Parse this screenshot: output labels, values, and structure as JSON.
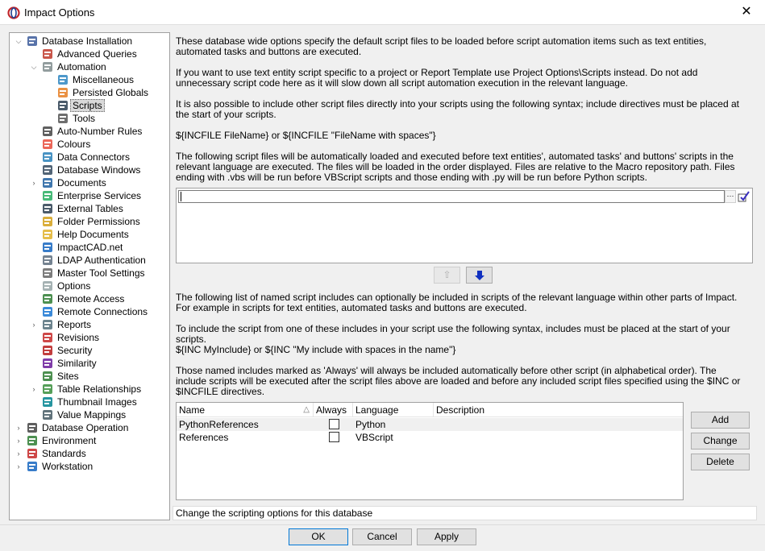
{
  "window": {
    "title": "Impact Options",
    "close_glyph": "✕"
  },
  "tree": {
    "items": [
      {
        "label": "Database Installation",
        "expander": "⌵",
        "icon": "db-install-icon"
      },
      {
        "label": "Advanced Queries",
        "expander": "",
        "icon": "sql-icon"
      },
      {
        "label": "Automation",
        "expander": "⌵",
        "icon": "gears-icon"
      },
      {
        "label": "Miscellaneous",
        "expander": "",
        "icon": "gears-icon"
      },
      {
        "label": "Persisted Globals",
        "expander": "",
        "icon": "globals-icon"
      },
      {
        "label": "Scripts",
        "expander": "",
        "icon": "script-icon"
      },
      {
        "label": "Tools",
        "expander": "",
        "icon": "tools-icon"
      },
      {
        "label": "Auto-Number Rules",
        "expander": "",
        "icon": "numbers-icon"
      },
      {
        "label": "Colours",
        "expander": "",
        "icon": "colours-icon"
      },
      {
        "label": "Data Connectors",
        "expander": "",
        "icon": "connectors-icon"
      },
      {
        "label": "Database Windows",
        "expander": "",
        "icon": "windows-icon"
      },
      {
        "label": "Documents",
        "expander": "›",
        "icon": "documents-icon"
      },
      {
        "label": "Enterprise Services",
        "expander": "",
        "icon": "enterprise-icon"
      },
      {
        "label": "External Tables",
        "expander": "",
        "icon": "tables-icon"
      },
      {
        "label": "Folder Permissions",
        "expander": "",
        "icon": "folder-icon"
      },
      {
        "label": "Help Documents",
        "expander": "",
        "icon": "help-icon"
      },
      {
        "label": "ImpactCAD.net",
        "expander": "",
        "icon": "globe-icon"
      },
      {
        "label": "LDAP Authentication",
        "expander": "",
        "icon": "ldap-icon"
      },
      {
        "label": "Master Tool Settings",
        "expander": "",
        "icon": "master-tool-icon"
      },
      {
        "label": "Options",
        "expander": "",
        "icon": "options-icon"
      },
      {
        "label": "Remote Access",
        "expander": "",
        "icon": "remote-access-icon"
      },
      {
        "label": "Remote Connections",
        "expander": "",
        "icon": "remote-connections-icon"
      },
      {
        "label": "Reports",
        "expander": "›",
        "icon": "reports-icon"
      },
      {
        "label": "Revisions",
        "expander": "",
        "icon": "revisions-icon"
      },
      {
        "label": "Security",
        "expander": "",
        "icon": "security-icon"
      },
      {
        "label": "Similarity",
        "expander": "",
        "icon": "similarity-icon"
      },
      {
        "label": "Sites",
        "expander": "",
        "icon": "sites-icon"
      },
      {
        "label": "Table Relationships",
        "expander": "›",
        "icon": "relationships-icon"
      },
      {
        "label": "Thumbnail Images",
        "expander": "",
        "icon": "thumbnail-icon"
      },
      {
        "label": "Value Mappings",
        "expander": "",
        "icon": "mappings-icon"
      },
      {
        "label": "Database Operation",
        "expander": "›",
        "icon": "db-operation-icon"
      },
      {
        "label": "Environment",
        "expander": "›",
        "icon": "environment-icon"
      },
      {
        "label": "Standards",
        "expander": "›",
        "icon": "standards-icon"
      },
      {
        "label": "Workstation",
        "expander": "›",
        "icon": "workstation-icon"
      }
    ]
  },
  "main": {
    "para1": "These database wide options specify the default script files to be loaded before script automation items such as text entities, automated tasks and buttons are executed.",
    "para2": "If you want to use text entity script specific to a project or Report Template use Project Options\\Scripts instead. Do not add unnecessary script code here as it will slow down all script automation execution in the relevant language.",
    "para3": "It is also possible to include other script files directly into your scripts using the following syntax; include directives must be placed at the start of your scripts.",
    "para4": "${INCFILE FileName} or ${INCFILE \"FileName with spaces\"}",
    "para5": "The following script files will be automatically loaded and executed before text entities', automated tasks' and buttons' scripts in the relevant language are executed. The files will be loaded in the order displayed. Files are relative to the Macro repository path. Files ending with .vbs will be run before VBScript scripts and those ending with .py will be run before Python scripts.",
    "file_input_value": "",
    "browse_label": "···",
    "para6": "The following list of named script includes can optionally be included in scripts of the relevant language within other parts of Impact. For example in scripts for text entities, automated tasks and buttons are executed.",
    "para7": "To include the script from one of these includes in your script use the following syntax, includes must be placed at the start of your scripts.",
    "para8": "${INC MyInclude} or ${INC \"My include with spaces in the name\"}",
    "para9": "Those named includes marked as 'Always' will always be included automatically before other script (in alphabetical order). The include scripts will be executed after the script files above are loaded and before any included script files specified using the $INC or $INCFILE directives."
  },
  "grid": {
    "columns": [
      "Name",
      "Always",
      "Language",
      "Description"
    ],
    "sort_glyph": "△",
    "rows": [
      {
        "name": "PythonReferences",
        "always": false,
        "language": "Python",
        "description": ""
      },
      {
        "name": "References",
        "always": false,
        "language": "VBScript",
        "description": ""
      }
    ]
  },
  "side_buttons": {
    "add": "Add",
    "change": "Change",
    "delete": "Delete"
  },
  "status_text": "Change the scripting options for this database",
  "footer": {
    "ok": "OK",
    "cancel": "Cancel",
    "apply": "Apply"
  }
}
